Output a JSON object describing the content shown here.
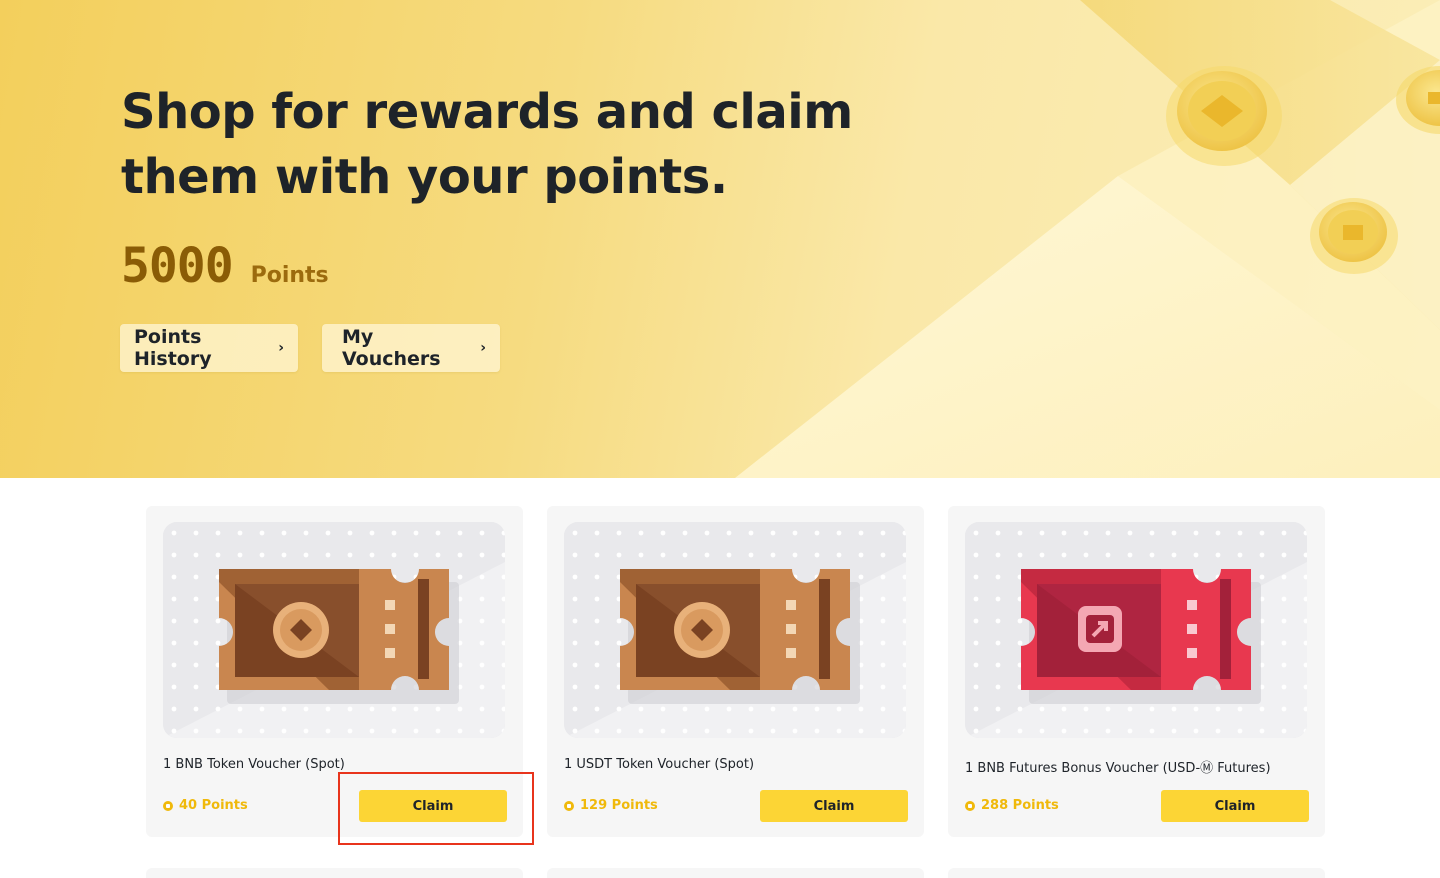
{
  "hero": {
    "title": "Shop for rewards and claim them with your points.",
    "points_value": "5000",
    "points_label": "Points",
    "buttons": [
      {
        "label": "Points History"
      },
      {
        "label": "My Vouchers"
      }
    ]
  },
  "vouchers": [
    {
      "title": "1 BNB Token Voucher (Spot)",
      "points": "40 Points",
      "claim_label": "Claim",
      "icon": "coin-ticket-icon",
      "color": "#c9864f"
    },
    {
      "title": "1 USDT Token Voucher (Spot)",
      "points": "129 Points",
      "claim_label": "Claim",
      "icon": "coin-ticket-icon",
      "color": "#c9864f"
    },
    {
      "title": "1 BNB Futures Bonus Voucher (USD-Ⓜ Futures)",
      "points": "288 Points",
      "claim_label": "Claim",
      "icon": "futures-ticket-icon",
      "color": "#e8384f"
    }
  ],
  "colors": {
    "accent": "#fcd535",
    "points_text": "#f0b90b",
    "highlight": "#e8341c"
  }
}
